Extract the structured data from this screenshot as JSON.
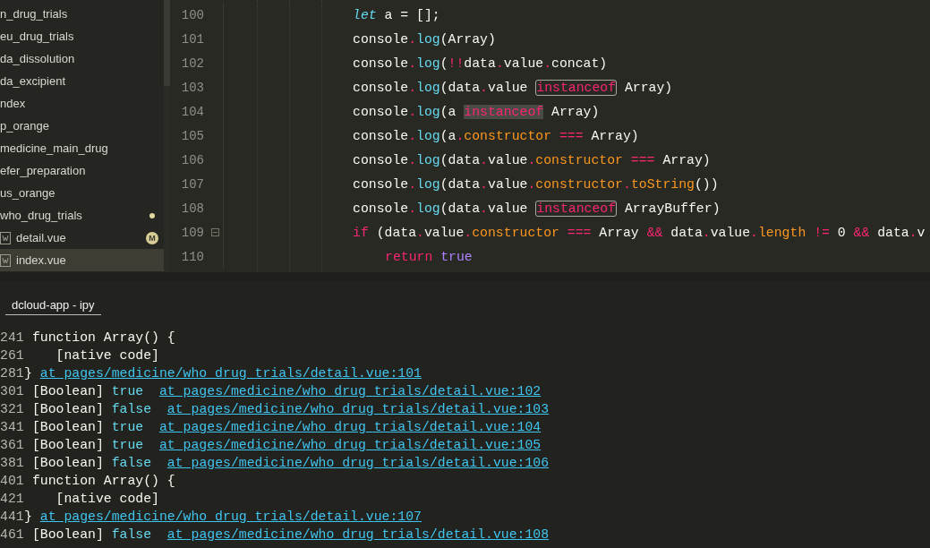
{
  "sidebar": {
    "items": [
      {
        "label": "n_drug_trials",
        "file": false,
        "selected": false,
        "modified_dot": false
      },
      {
        "label": "eu_drug_trials",
        "file": false,
        "selected": false,
        "modified_dot": false
      },
      {
        "label": "da_dissolution",
        "file": false,
        "selected": false,
        "modified_dot": false
      },
      {
        "label": "da_excipient",
        "file": false,
        "selected": false,
        "modified_dot": false
      },
      {
        "label": "ndex",
        "file": false,
        "selected": false,
        "modified_dot": false
      },
      {
        "label": "p_orange",
        "file": false,
        "selected": false,
        "modified_dot": false
      },
      {
        "label": "medicine_main_drug",
        "file": false,
        "selected": false,
        "modified_dot": false
      },
      {
        "label": "efer_preparation",
        "file": false,
        "selected": false,
        "modified_dot": false
      },
      {
        "label": "us_orange",
        "file": false,
        "selected": false,
        "modified_dot": false
      },
      {
        "label": "who_drug_trials",
        "file": false,
        "selected": false,
        "modified_dot": true
      },
      {
        "label": "detail.vue",
        "file": true,
        "selected": false,
        "modified_dot": false,
        "badge": "M"
      },
      {
        "label": "index.vue",
        "file": true,
        "selected": true,
        "modified_dot": false
      }
    ]
  },
  "editor": {
    "lines": [
      {
        "number": "100",
        "tokens": [
          {
            "text": "let",
            "kind": "storage"
          },
          {
            "text": " a = [];",
            "kind": "plain"
          }
        ]
      },
      {
        "number": "101",
        "tokens": [
          {
            "text": "console",
            "kind": "plain"
          },
          {
            "text": ".",
            "kind": "op"
          },
          {
            "text": "log",
            "kind": "fn"
          },
          {
            "text": "(Array)",
            "kind": "plain"
          }
        ]
      },
      {
        "number": "102",
        "tokens": [
          {
            "text": "console",
            "kind": "plain"
          },
          {
            "text": ".",
            "kind": "op"
          },
          {
            "text": "log",
            "kind": "fn"
          },
          {
            "text": "(",
            "kind": "plain"
          },
          {
            "text": "!!",
            "kind": "op"
          },
          {
            "text": "data",
            "kind": "plain"
          },
          {
            "text": ".",
            "kind": "op"
          },
          {
            "text": "value",
            "kind": "plain"
          },
          {
            "text": ".",
            "kind": "op"
          },
          {
            "text": "concat)",
            "kind": "plain"
          }
        ]
      },
      {
        "number": "103",
        "tokens": [
          {
            "text": "console",
            "kind": "plain"
          },
          {
            "text": ".",
            "kind": "op"
          },
          {
            "text": "log",
            "kind": "fn"
          },
          {
            "text": "(data",
            "kind": "plain"
          },
          {
            "text": ".",
            "kind": "op"
          },
          {
            "text": "value ",
            "kind": "plain"
          },
          {
            "text": "instanceof",
            "kind": "boxed"
          },
          {
            "text": " Array)",
            "kind": "plain"
          }
        ]
      },
      {
        "number": "104",
        "tokens": [
          {
            "text": "console",
            "kind": "plain"
          },
          {
            "text": ".",
            "kind": "op"
          },
          {
            "text": "log",
            "kind": "fn"
          },
          {
            "text": "(a ",
            "kind": "plain"
          },
          {
            "text": "instanceof",
            "kind": "highlight"
          },
          {
            "text": " Array)",
            "kind": "plain"
          }
        ]
      },
      {
        "number": "105",
        "tokens": [
          {
            "text": "console",
            "kind": "plain"
          },
          {
            "text": ".",
            "kind": "op"
          },
          {
            "text": "log",
            "kind": "fn"
          },
          {
            "text": "(a",
            "kind": "plain"
          },
          {
            "text": ".",
            "kind": "op"
          },
          {
            "text": "constructor",
            "kind": "prop"
          },
          {
            "text": " ===",
            "kind": "op"
          },
          {
            "text": " Array)",
            "kind": "plain"
          }
        ]
      },
      {
        "number": "106",
        "tokens": [
          {
            "text": "console",
            "kind": "plain"
          },
          {
            "text": ".",
            "kind": "op"
          },
          {
            "text": "log",
            "kind": "fn"
          },
          {
            "text": "(data",
            "kind": "plain"
          },
          {
            "text": ".",
            "kind": "op"
          },
          {
            "text": "value",
            "kind": "plain"
          },
          {
            "text": ".",
            "kind": "op"
          },
          {
            "text": "constructor",
            "kind": "prop"
          },
          {
            "text": " ===",
            "kind": "op"
          },
          {
            "text": " Array)",
            "kind": "plain"
          }
        ]
      },
      {
        "number": "107",
        "tokens": [
          {
            "text": "console",
            "kind": "plain"
          },
          {
            "text": ".",
            "kind": "op"
          },
          {
            "text": "log",
            "kind": "fn"
          },
          {
            "text": "(data",
            "kind": "plain"
          },
          {
            "text": ".",
            "kind": "op"
          },
          {
            "text": "value",
            "kind": "plain"
          },
          {
            "text": ".",
            "kind": "op"
          },
          {
            "text": "constructor",
            "kind": "prop"
          },
          {
            "text": ".",
            "kind": "op"
          },
          {
            "text": "toString",
            "kind": "prop"
          },
          {
            "text": "())",
            "kind": "plain"
          }
        ]
      },
      {
        "number": "108",
        "tokens": [
          {
            "text": "console",
            "kind": "plain"
          },
          {
            "text": ".",
            "kind": "op"
          },
          {
            "text": "log",
            "kind": "fn"
          },
          {
            "text": "(data",
            "kind": "plain"
          },
          {
            "text": ".",
            "kind": "op"
          },
          {
            "text": "value ",
            "kind": "plain"
          },
          {
            "text": "instanceof",
            "kind": "boxed"
          },
          {
            "text": " ArrayBuffer)",
            "kind": "plain"
          }
        ]
      },
      {
        "number": "109",
        "tokens": [
          {
            "text": "if",
            "kind": "keyword"
          },
          {
            "text": " (data",
            "kind": "plain"
          },
          {
            "text": ".",
            "kind": "op"
          },
          {
            "text": "value",
            "kind": "plain"
          },
          {
            "text": ".",
            "kind": "op"
          },
          {
            "text": "constructor",
            "kind": "prop"
          },
          {
            "text": " ===",
            "kind": "op"
          },
          {
            "text": " Array ",
            "kind": "plain"
          },
          {
            "text": "&&",
            "kind": "op"
          },
          {
            "text": " data",
            "kind": "plain"
          },
          {
            "text": ".",
            "kind": "op"
          },
          {
            "text": "value",
            "kind": "plain"
          },
          {
            "text": ".",
            "kind": "op"
          },
          {
            "text": "length",
            "kind": "prop"
          },
          {
            "text": " !=",
            "kind": "op"
          },
          {
            "text": " 0 ",
            "kind": "plain"
          },
          {
            "text": "&&",
            "kind": "op"
          },
          {
            "text": " data",
            "kind": "plain"
          },
          {
            "text": ".",
            "kind": "op"
          },
          {
            "text": "v",
            "kind": "plain"
          }
        ],
        "children": [
          {
            "number": "110",
            "tokens": [
              {
                "text": "return",
                "kind": "keyword"
              },
              {
                "text": " true",
                "kind": "constant"
              }
            ]
          }
        ]
      }
    ]
  },
  "console": {
    "tab": "dcloud-app - ipy",
    "lines": [
      {
        "number": "241",
        "tokens": [
          {
            "text": " function Array() {",
            "kind": "plain"
          }
        ]
      },
      {
        "number": "261",
        "tokens": [
          {
            "text": "    [native code]",
            "kind": "plain"
          }
        ]
      },
      {
        "number": "281",
        "tokens": [
          {
            "text": "} ",
            "kind": "plain"
          },
          {
            "text": "at pages/medicine/who_drug_trials/detail.vue:101",
            "kind": "link"
          }
        ]
      },
      {
        "number": "301",
        "tokens": [
          {
            "text": " [Boolean] ",
            "kind": "plain"
          },
          {
            "text": "true  ",
            "kind": "value"
          },
          {
            "text": "at pages/medicine/who_drug_trials/detail.vue:102",
            "kind": "link"
          }
        ]
      },
      {
        "number": "321",
        "tokens": [
          {
            "text": " [Boolean] ",
            "kind": "plain"
          },
          {
            "text": "false  ",
            "kind": "value"
          },
          {
            "text": "at pages/medicine/who_drug_trials/detail.vue:103",
            "kind": "link"
          }
        ]
      },
      {
        "number": "341",
        "tokens": [
          {
            "text": " [Boolean] ",
            "kind": "plain"
          },
          {
            "text": "true  ",
            "kind": "value"
          },
          {
            "text": "at pages/medicine/who_drug_trials/detail.vue:104",
            "kind": "link"
          }
        ]
      },
      {
        "number": "361",
        "tokens": [
          {
            "text": " [Boolean] ",
            "kind": "plain"
          },
          {
            "text": "true  ",
            "kind": "value"
          },
          {
            "text": "at pages/medicine/who_drug_trials/detail.vue:105",
            "kind": "link"
          }
        ]
      },
      {
        "number": "381",
        "tokens": [
          {
            "text": " [Boolean] ",
            "kind": "plain"
          },
          {
            "text": "false  ",
            "kind": "value"
          },
          {
            "text": "at pages/medicine/who_drug_trials/detail.vue:106",
            "kind": "link"
          }
        ]
      },
      {
        "number": "401",
        "tokens": [
          {
            "text": " function Array() {",
            "kind": "plain"
          }
        ]
      },
      {
        "number": "421",
        "tokens": [
          {
            "text": "    [native code]",
            "kind": "plain"
          }
        ]
      },
      {
        "number": "441",
        "tokens": [
          {
            "text": "} ",
            "kind": "plain"
          },
          {
            "text": "at pages/medicine/who_drug_trials/detail.vue:107",
            "kind": "link"
          }
        ]
      },
      {
        "number": "461",
        "tokens": [
          {
            "text": " [Boolean] ",
            "kind": "plain"
          },
          {
            "text": "false  ",
            "kind": "value"
          },
          {
            "text": "at pages/medicine/who_drug_trials/detail.vue:108",
            "kind": "link"
          }
        ]
      }
    ]
  }
}
